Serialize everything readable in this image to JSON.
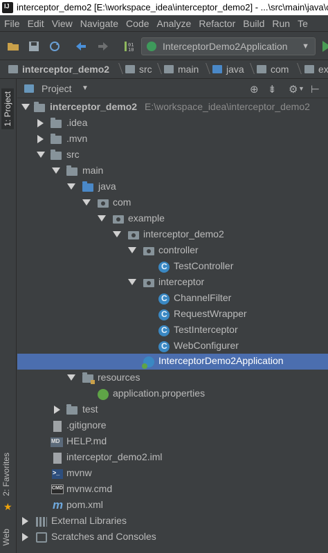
{
  "window": {
    "title": "interceptor_demo2 [E:\\workspace_idea\\interceptor_demo2] - ...\\src\\main\\java\\co"
  },
  "menu": [
    "File",
    "Edit",
    "View",
    "Navigate",
    "Code",
    "Analyze",
    "Refactor",
    "Build",
    "Run",
    "Te"
  ],
  "toolbar": {
    "run_config": "InterceptorDemo2Application"
  },
  "breadcrumbs": [
    "interceptor_demo2",
    "src",
    "main",
    "java",
    "com",
    "ex"
  ],
  "side_tabs": {
    "project": "1: Project",
    "favorites": "2: Favorites",
    "web": "Web"
  },
  "project_panel": {
    "title": "Project"
  },
  "tree": [
    {
      "label": "interceptor_demo2",
      "path": "E:\\workspace_idea\\interceptor_demo2"
    },
    {
      "label": ".idea"
    },
    {
      "label": ".mvn"
    },
    {
      "label": "src"
    },
    {
      "label": "main"
    },
    {
      "label": "java"
    },
    {
      "label": "com"
    },
    {
      "label": "example"
    },
    {
      "label": "interceptor_demo2"
    },
    {
      "label": "controller"
    },
    {
      "label": "TestController"
    },
    {
      "label": "interceptor"
    },
    {
      "label": "ChannelFilter"
    },
    {
      "label": "RequestWrapper"
    },
    {
      "label": "TestInterceptor"
    },
    {
      "label": "WebConfigurer"
    },
    {
      "label": "InterceptorDemo2Application"
    },
    {
      "label": "resources"
    },
    {
      "label": "application.properties"
    },
    {
      "label": "test"
    },
    {
      "label": ".gitignore"
    },
    {
      "label": "HELP.md"
    },
    {
      "label": "interceptor_demo2.iml"
    },
    {
      "label": "mvnw"
    },
    {
      "label": "mvnw.cmd"
    },
    {
      "label": "pom.xml"
    },
    {
      "label": "External Libraries"
    },
    {
      "label": "Scratches and Consoles"
    }
  ]
}
